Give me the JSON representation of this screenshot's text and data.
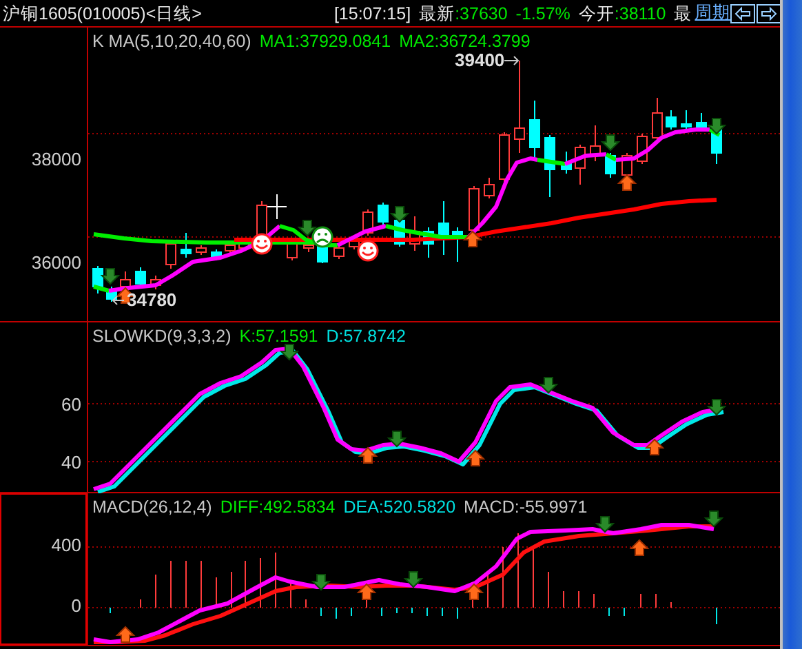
{
  "header": {
    "title": "沪铜1605(010005)<日线>",
    "time": "[15:07:15]",
    "latest_label": "最新",
    "latest_value": ":37630",
    "change": "-1.57%",
    "open_label": "今开",
    "open_value": ":38110",
    "high_label": "最",
    "period_link": "周期"
  },
  "main_panel": {
    "legend": [
      {
        "text": "K  MA(5,10,20,40,60)",
        "color": "#c8c8c8"
      },
      {
        "text": "MA1:37929.0841",
        "color": "#00e800"
      },
      {
        "text": "MA2:36724.3799",
        "color": "#00e800"
      }
    ],
    "y_ticks": [
      "38000",
      "36000"
    ],
    "high_marker": "39400",
    "low_marker": "34780"
  },
  "kd_panel": {
    "legend": [
      {
        "text": "SLOWKD(9,3,3,2)",
        "color": "#c8c8c8"
      },
      {
        "text": "K:57.1591",
        "color": "#00e800"
      },
      {
        "text": "D:57.8742",
        "color": "#00e0e0"
      }
    ],
    "y_ticks": [
      "60",
      "40"
    ]
  },
  "macd_panel": {
    "selected": true,
    "legend": [
      {
        "text": "MACD(26,12,4)",
        "color": "#c8c8c8"
      },
      {
        "text": "DIFF:492.5834",
        "color": "#00e800"
      },
      {
        "text": "DEA:520.5820",
        "color": "#00e0e0"
      },
      {
        "text": "MACD:-55.9971",
        "color": "#c8c8c8"
      }
    ],
    "y_ticks": [
      "400",
      "0"
    ]
  }
}
